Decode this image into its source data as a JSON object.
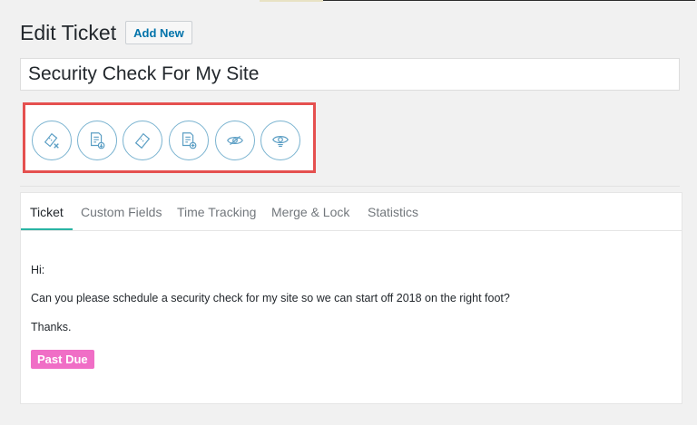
{
  "page": {
    "title": "Edit Ticket",
    "add_new_label": "Add New"
  },
  "ticket": {
    "title_value": "Security Check For My Site"
  },
  "actions": [
    {
      "icon": "ticket-close-icon"
    },
    {
      "icon": "document-download-icon"
    },
    {
      "icon": "ticket-icon"
    },
    {
      "icon": "document-add-icon"
    },
    {
      "icon": "eye-watch-icon"
    },
    {
      "icon": "eye-unwatch-icon"
    }
  ],
  "tabs": [
    {
      "label": "Ticket",
      "active": true
    },
    {
      "label": "Custom Fields",
      "active": false
    },
    {
      "label": "Time Tracking",
      "active": false
    },
    {
      "label": "Merge & Lock",
      "active": false
    },
    {
      "label": "Statistics",
      "active": false
    }
  ],
  "message": {
    "greeting": "Hi:",
    "body": "Can you please schedule a security check for my site so we can start off 2018 on the right foot?",
    "closing": "Thanks."
  },
  "status": {
    "label": "Past Due",
    "color": "#f06ec6"
  },
  "colors": {
    "highlight_border": "#e5504f",
    "icon_stroke": "#5b9ec4",
    "active_tab": "#2ab4a4",
    "link": "#0073aa"
  }
}
